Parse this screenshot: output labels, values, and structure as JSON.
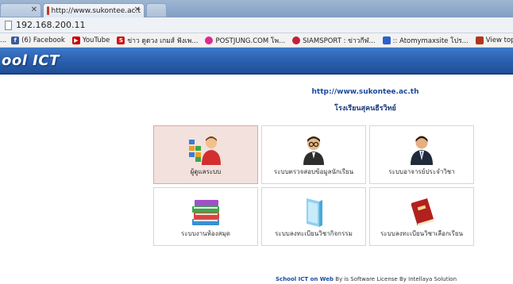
{
  "browser": {
    "tabs": [
      {
        "label": "",
        "active": false
      },
      {
        "label": "http://www.sukontee.ac.t",
        "active": true
      }
    ],
    "address": "192.168.200.11",
    "bookmarks": [
      {
        "label": "(6) Facebook",
        "icon": "facebook-icon",
        "color": "#3b5998"
      },
      {
        "label": "YouTube",
        "icon": "youtube-icon",
        "color": "#cc0000"
      },
      {
        "label": "ข่าว ดูดวง เกมส์ ฟังเพ...",
        "icon": "sanook-icon",
        "color": "#d01616"
      },
      {
        "label": "POSTJUNG.COM โพ...",
        "icon": "postjung-icon",
        "color": "#e0298f"
      },
      {
        "label": "SIAMSPORT : ข่าวกีฬ...",
        "icon": "siamsport-icon",
        "color": "#c0223a"
      },
      {
        "label": ":: Atomymaxsite โปร...",
        "icon": "atomy-icon",
        "color": "#2a62c9"
      },
      {
        "label": "View topic :: SiamBL...",
        "icon": "siambl-icon",
        "color": "#b3341c"
      }
    ]
  },
  "site": {
    "header_title": "ool ICT",
    "url": "http://www.sukontee.ac.th",
    "school_name": "โรงเรียนสุคนธีรวิทย์"
  },
  "modules": [
    {
      "label": "ผู้ดูแลระบบ",
      "icon": "admin-user-icon",
      "selected": true
    },
    {
      "label": "ระบบตรวจสอบข้อมูลนักเรียน",
      "icon": "student-check-icon",
      "selected": false
    },
    {
      "label": "ระบบอาจารย์ประจำวิชา",
      "icon": "teacher-icon",
      "selected": false
    },
    {
      "label": "ระบบงานห้องสมุด",
      "icon": "library-books-icon",
      "selected": false
    },
    {
      "label": "ระบบลงทะเบียนวิชากิจกรรม",
      "icon": "activity-folder-icon",
      "selected": false
    },
    {
      "label": "ระบบลงทะเบียนวิชาเลือกเรียน",
      "icon": "elective-book-icon",
      "selected": false
    }
  ],
  "footer": {
    "brand": "School ICT on Web",
    "text": " By is Software License By Intellaya Solution"
  }
}
